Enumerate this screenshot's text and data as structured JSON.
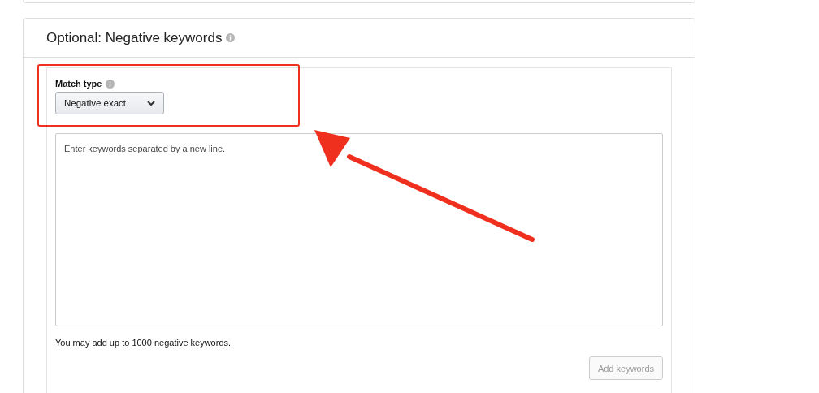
{
  "section": {
    "title": "Optional: Negative keywords"
  },
  "match_type": {
    "label": "Match type",
    "value": "Negative exact"
  },
  "keywords_field": {
    "placeholder": "Enter keywords separated by a new line."
  },
  "help_text": "You may add up to 1000 negative keywords.",
  "add_button": {
    "label": "Add keywords",
    "disabled": true
  }
}
